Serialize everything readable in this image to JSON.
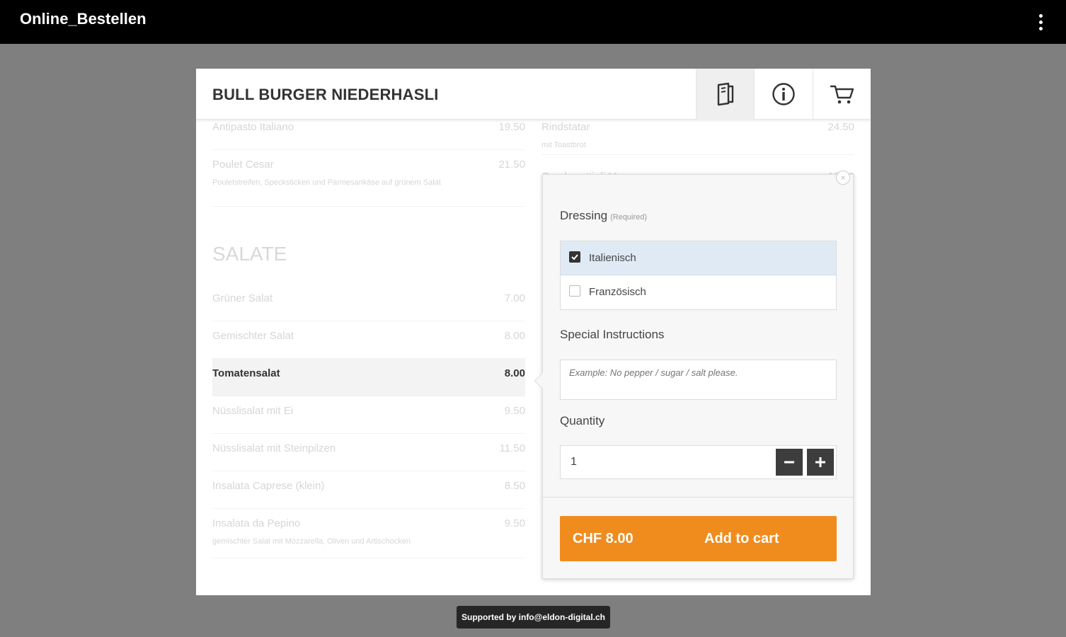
{
  "app": {
    "title": "Online_Bestellen"
  },
  "restaurant": {
    "name": "BULL BURGER NIEDERHASLI"
  },
  "icons": {
    "menu": "menu-book-icon",
    "info": "info-icon",
    "cart": "cart-icon",
    "overflow": "more-vert-icon",
    "close": "close-icon",
    "check": "check-icon",
    "minus": "minus-icon",
    "plus": "plus-icon"
  },
  "colors": {
    "accent": "#f08c1e",
    "selected_option_bg": "#dfeaf4",
    "appbar": "#000000"
  },
  "left_items": [
    {
      "name": "Antipasto Italiano",
      "price": "19.50"
    },
    {
      "name": "Poulet Cesar",
      "price": "21.50",
      "desc": "Pouletstreifen, Specksticken und Parmesankäse auf grünem Salat"
    }
  ],
  "section": {
    "title": "SALATE"
  },
  "salate": [
    {
      "name": "Grüner Salat",
      "price": "7.00"
    },
    {
      "name": "Gemischter Salat",
      "price": "8.00"
    },
    {
      "name": "Tomatensalat",
      "price": "8.00"
    },
    {
      "name": "Nüsslisalat mit Ei",
      "price": "9.50"
    },
    {
      "name": "Nüsslisalat mit Steinpilzen",
      "price": "11.50"
    },
    {
      "name": "Insalata Caprese (klein)",
      "price": "8.50"
    },
    {
      "name": "Insalata da Pepino",
      "price": "9.50",
      "desc": "gemischter Salat mit Mozzarella, Oliven und Artischocken"
    }
  ],
  "right_items": [
    {
      "name": "Rindstatar",
      "price": "24.50",
      "desc": "mit Toastbrot"
    },
    {
      "name": "Gamberetti di Mango",
      "price": "19.50"
    }
  ],
  "popup": {
    "close_label": "×",
    "dressing_label": "Dressing",
    "required_label": "(Required)",
    "options": [
      {
        "label": "Italienisch",
        "checked": true
      },
      {
        "label": "Französisch",
        "checked": false
      }
    ],
    "special_label": "Special Instructions",
    "special_placeholder": "Example: No pepper / sugar / salt please.",
    "quantity_label": "Quantity",
    "quantity_value": "1",
    "price": "CHF 8.00",
    "add_label": "Add to cart"
  },
  "footer": {
    "support": "Supported by info@eldon-digital.ch"
  }
}
